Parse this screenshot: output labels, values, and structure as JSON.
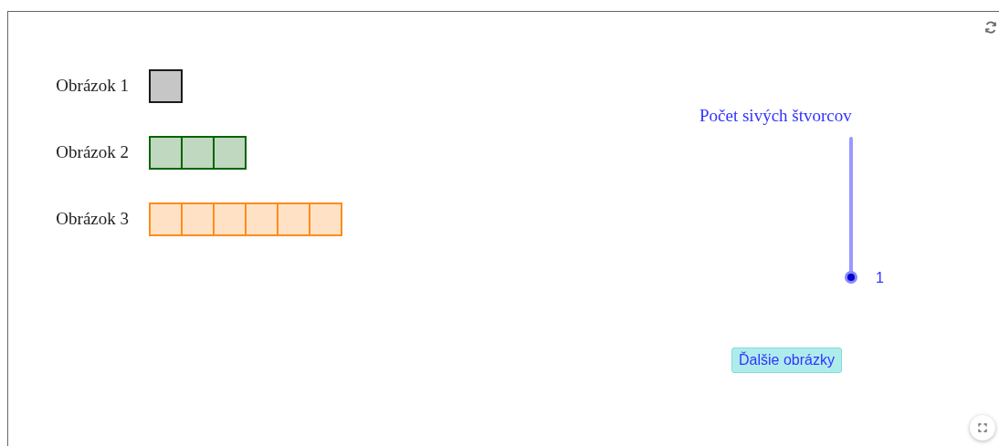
{
  "figures": [
    {
      "label": "Obrázok 1",
      "squares": [
        {
          "color": "#1a1a1a"
        }
      ]
    },
    {
      "label": "Obrázok 2",
      "squares": [
        {
          "color": "#006400"
        },
        {
          "color": "#006400"
        },
        {
          "color": "#006400"
        }
      ]
    },
    {
      "label": "Obrázok 3",
      "squares": [
        {
          "color": "#ff8c1a"
        },
        {
          "color": "#ff8c1a"
        },
        {
          "color": "#ff8c1a"
        },
        {
          "color": "#ff8c1a"
        },
        {
          "color": "#ff8c1a"
        },
        {
          "color": "#ff8c1a"
        }
      ]
    }
  ],
  "slider": {
    "label": "Počet sivých štvorcov",
    "level": 0,
    "reading": "1"
  },
  "button": {
    "label": "Ďalšie obrázky"
  }
}
